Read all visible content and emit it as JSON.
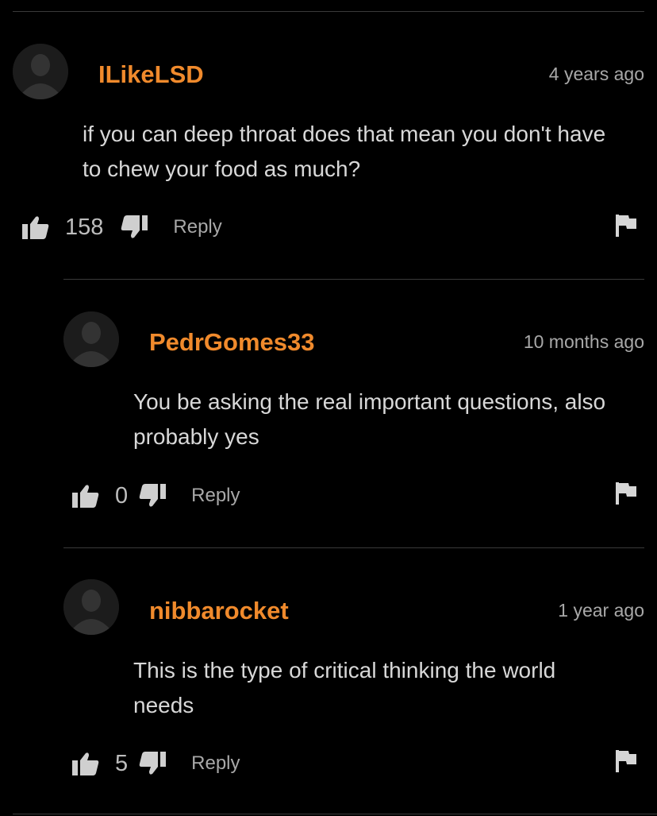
{
  "comments": [
    {
      "username": "ILikeLSD",
      "timestamp": "4 years ago",
      "text_lines": [
        "if you can deep throat does that mean you don't have",
        "to chew your food as much?"
      ],
      "likes": "158",
      "reply_label": "Reply"
    },
    {
      "username": "PedrGomes33",
      "timestamp": "10 months ago",
      "text_lines": [
        "You be asking the real important questions, also",
        "probably yes"
      ],
      "likes": "0",
      "reply_label": "Reply"
    },
    {
      "username": "nibbarocket",
      "timestamp": "1 year ago",
      "text_lines": [
        "This is the type of critical thinking the world",
        "needs"
      ],
      "likes": "5",
      "reply_label": "Reply"
    }
  ],
  "colors": {
    "username": "#f08a2c",
    "background": "#000000",
    "text": "#d8d8d8",
    "muted": "#a8a8a8"
  },
  "icons": {
    "avatar": "default-user-avatar-icon",
    "like": "thumbs-up-icon",
    "dislike": "thumbs-down-icon",
    "flag": "flag-icon"
  }
}
